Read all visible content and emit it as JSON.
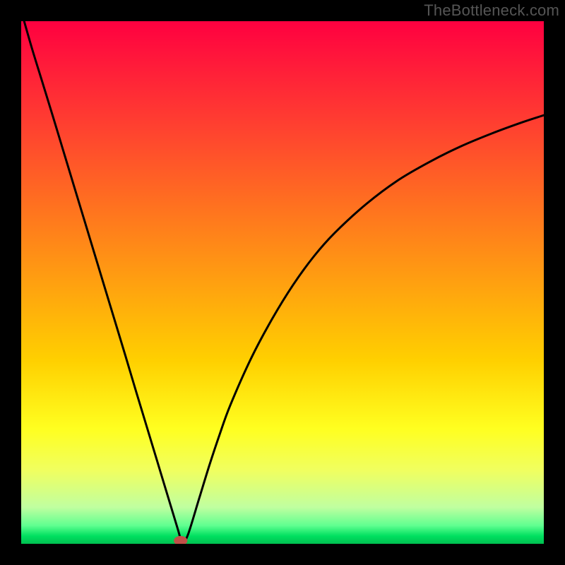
{
  "watermark": "TheBottleneck.com",
  "chart_data": {
    "type": "line",
    "title": "",
    "xlabel": "",
    "ylabel": "",
    "xlim": [
      0,
      100
    ],
    "ylim": [
      0,
      100
    ],
    "background_gradient": {
      "stops": [
        {
          "offset": 0.0,
          "color": "#ff0040"
        },
        {
          "offset": 0.08,
          "color": "#ff1a3a"
        },
        {
          "offset": 0.2,
          "color": "#ff4030"
        },
        {
          "offset": 0.35,
          "color": "#ff7020"
        },
        {
          "offset": 0.5,
          "color": "#ffa010"
        },
        {
          "offset": 0.65,
          "color": "#ffd000"
        },
        {
          "offset": 0.78,
          "color": "#ffff20"
        },
        {
          "offset": 0.86,
          "color": "#f0ff60"
        },
        {
          "offset": 0.93,
          "color": "#c0ffa0"
        },
        {
          "offset": 0.965,
          "color": "#60ff90"
        },
        {
          "offset": 0.985,
          "color": "#00e060"
        },
        {
          "offset": 1.0,
          "color": "#00c050"
        }
      ]
    },
    "series": [
      {
        "name": "bottleneck-curve",
        "x": [
          0,
          2,
          4,
          6,
          8,
          10,
          12,
          14,
          16,
          18,
          20,
          22,
          24,
          26,
          28,
          29,
          30,
          30.5,
          31,
          32,
          34,
          36,
          38,
          40,
          44,
          48,
          52,
          56,
          60,
          66,
          72,
          78,
          84,
          90,
          96,
          100
        ],
        "values": [
          102,
          95,
          88.5,
          82,
          75.4,
          68.8,
          62.2,
          55.6,
          49,
          42.4,
          35.8,
          29.1,
          22.5,
          15.9,
          9.3,
          6,
          2.7,
          1,
          0.2,
          2,
          8.5,
          15,
          21,
          26.5,
          35.5,
          43,
          49.5,
          55,
          59.5,
          65,
          69.5,
          73,
          76,
          78.5,
          80.7,
          82
        ]
      }
    ],
    "marker": {
      "name": "optimal-point",
      "x": 30.5,
      "y": 0.6,
      "rx": 1.3,
      "ry": 0.9,
      "color": "#c05048"
    }
  }
}
